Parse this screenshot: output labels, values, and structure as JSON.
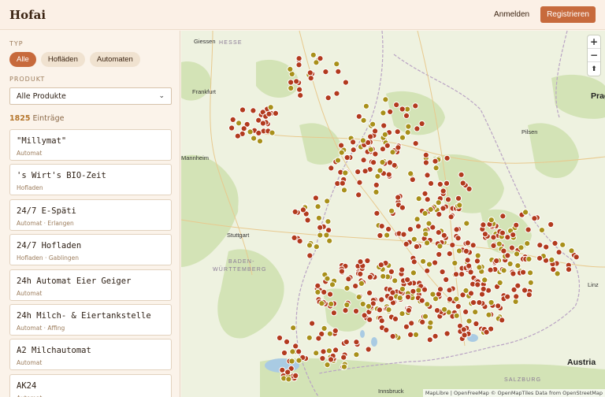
{
  "header": {
    "logo": "Hofai",
    "login_label": "Anmelden",
    "register_label": "Registrieren"
  },
  "filters": {
    "type_label": "TYP",
    "type_options": [
      "Alle",
      "Hofläden",
      "Automaten"
    ],
    "active_type": "Alle",
    "product_label": "PRODUKT",
    "product_value": "Alle Produkte"
  },
  "results": {
    "count": "1825",
    "count_suffix": "Einträge"
  },
  "entries": [
    {
      "name": "\"Millymat\"",
      "meta": "Automat"
    },
    {
      "name": "'s Wirt's BIO-Zeit",
      "meta": "Hofladen"
    },
    {
      "name": "24/7 E-Späti",
      "meta": "Automat · Erlangen"
    },
    {
      "name": "24/7 Hofladen",
      "meta": "Hofladen · Gablingen"
    },
    {
      "name": "24h Automat Eier Geiger",
      "meta": "Automat"
    },
    {
      "name": "24h Milch- & Eiertankstelle",
      "meta": "Automat · Affing"
    },
    {
      "name": "A2 Milchautomat",
      "meta": "Automat"
    },
    {
      "name": "AK24",
      "meta": "Automat"
    }
  ],
  "map": {
    "cities": [
      "Giessen",
      "Frankfurt",
      "Mannheim",
      "Stuttgart",
      "Pilsen",
      "Linz",
      "Innsbruck",
      "Salzburg"
    ],
    "regions": [
      "HESSE",
      "BADEN-",
      "WÜRTTEMBERG",
      "SALZBURG"
    ],
    "countries": [
      "Prag",
      "Austria"
    ],
    "zoom_in": "+",
    "zoom_out": "−",
    "reset_bearing": "⬆",
    "attribution": "MapLibre | OpenFreeMap © OpenMapTiles Data from OpenStreetMap",
    "colors": {
      "marker_farm": "#b23a1e",
      "marker_machine": "#a8901a",
      "forest": "#cfe0b0",
      "water": "#a9cbe3"
    }
  }
}
